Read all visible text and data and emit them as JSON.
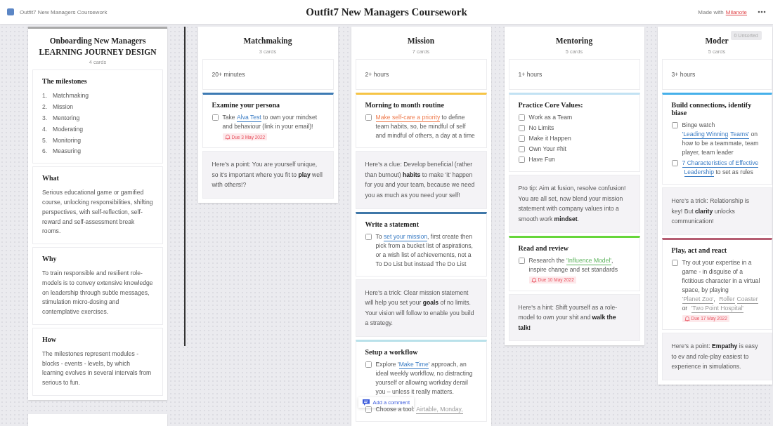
{
  "header": {
    "app_title": "Outfit7 New Managers Coursework",
    "board_title": "Outfit7 New Managers Coursework",
    "made_with": "Made with",
    "brand": "Milanote"
  },
  "unsorted_badge": "0 Unsorted",
  "columns": [
    {
      "kind": "intro",
      "title": "Onboarding New Managers\nLEARNING JOURNEY DESIGN",
      "count": "4 cards",
      "cards": [
        {
          "kind": "list",
          "title": "The milestones",
          "items": [
            {
              "number": "1.",
              "text": "Matchmaking"
            },
            {
              "number": "2.",
              "text": "Mission"
            },
            {
              "number": "3.",
              "text": "Mentoring"
            },
            {
              "number": "4.",
              "text": "Moderating"
            },
            {
              "number": "5.",
              "text": "Monitoring"
            },
            {
              "number": "6.",
              "text": "Measuring"
            }
          ]
        },
        {
          "kind": "section",
          "title": "What",
          "text": "Serious educational game or gamified course, unlocking responsibilities, shifting perspectives, with self-reflection, self-reward and self-assessment break rooms."
        },
        {
          "kind": "section",
          "title": "Why",
          "text": "To train responsible and resilient role-models is to convey extensive knowledge on leadership through subtle messages, stimulation micro-dosing and contemplative exercises."
        },
        {
          "kind": "section",
          "title": "How",
          "text": "The milestones represent modules - blocks - events - levels, by which learning evolves in several intervals from serious to fun."
        }
      ]
    },
    {
      "kind": "stage",
      "title": "Matchmaking",
      "count": "3 cards",
      "cards": [
        {
          "kind": "duration",
          "text": "20+ minutes"
        },
        {
          "kind": "task",
          "title": "Examine your persona",
          "color": "#3d7ab3",
          "tasks": [
            {
              "checked": false,
              "parts": [
                {
                  "kind": "text",
                  "text": "Take "
                },
                {
                  "kind": "link",
                  "text": "Alva Test",
                  "color": "#3a7cc4"
                },
                {
                  "kind": "text",
                  "text": " to own your mindset and behaviour (link in your email)!"
                }
              ],
              "due": "Due 3 May 2022"
            }
          ]
        },
        {
          "kind": "note",
          "text": "Here's a point: You are yourself unique, so it's important where you fit to **play** well with others!?"
        }
      ]
    },
    {
      "kind": "stage",
      "title": "Mission",
      "count": "7 cards",
      "cards": [
        {
          "kind": "duration",
          "text": "2+ hours"
        },
        {
          "kind": "task",
          "title": "Morning to month routine",
          "color": "#f6c445",
          "tasks": [
            {
              "checked": false,
              "parts": [
                {
                  "kind": "link",
                  "text": "Make self-care a priority",
                  "color": "#ef7a4c"
                },
                {
                  "kind": "text",
                  "text": " to define team habits, so, be mindful of self and mindful of others, a day at a time"
                }
              ]
            }
          ]
        },
        {
          "kind": "note",
          "text": "Here's a clue: Develop beneficial (rather than burnout) **habits** to make 'it' happen for you and your team, because we need you as much as you need your self!"
        },
        {
          "kind": "task",
          "title": "Write a statement",
          "color": "#3f77a8",
          "tasks": [
            {
              "checked": false,
              "parts": [
                {
                  "kind": "text",
                  "text": "To "
                },
                {
                  "kind": "link",
                  "text": "set your mission",
                  "color": "#3a7cc4"
                },
                {
                  "kind": "text",
                  "text": ", first create then pick from a bucket list of aspirations, or a wish list of achievements, not a To Do List but instead The Do List"
                }
              ]
            }
          ]
        },
        {
          "kind": "note",
          "text": "Here's a trick: Clear mission statement will help you set your **goals** of no limits. Your vision will follow to enable you build a strategy."
        },
        {
          "kind": "task",
          "title": "Setup a workflow",
          "color": "#b9e1ea",
          "tasks": [
            {
              "checked": false,
              "parts": [
                {
                  "kind": "text",
                  "text": "Explore '"
                },
                {
                  "kind": "link",
                  "text": "Make Time",
                  "color": "#3a7cc4"
                },
                {
                  "kind": "text",
                  "text": "' approach, an ideal weekly workflow, no distracting yourself or allowing workday derail you – unless it really matters."
                }
              ],
              "comment_prompt": "Add a comment"
            },
            {
              "checked": false,
              "parts": [
                {
                  "kind": "text",
                  "text": "Choose a tool: "
                },
                {
                  "kind": "link",
                  "text": "Airtable, Monday,",
                  "color": "#9a9a9a"
                }
              ]
            }
          ]
        }
      ]
    },
    {
      "kind": "stage",
      "title": "Mentoring",
      "count": "5 cards",
      "cards": [
        {
          "kind": "duration",
          "text": "1+ hours"
        },
        {
          "kind": "task",
          "title": "Practice Core Values:",
          "color": "#c2e2f3",
          "tasks": [
            {
              "checked": false,
              "parts": [
                {
                  "kind": "text",
                  "text": "Work as a Team"
                }
              ]
            },
            {
              "checked": false,
              "parts": [
                {
                  "kind": "text",
                  "text": "No Limits"
                }
              ]
            },
            {
              "checked": false,
              "parts": [
                {
                  "kind": "text",
                  "text": "Make it Happen"
                }
              ]
            },
            {
              "checked": false,
              "parts": [
                {
                  "kind": "text",
                  "text": "Own Your #hit"
                }
              ]
            },
            {
              "checked": false,
              "parts": [
                {
                  "kind": "text",
                  "text": "Have Fun"
                }
              ]
            }
          ]
        },
        {
          "kind": "note",
          "text": "Pro tip: Aim at fusion, resolve confusion! You are all set, now blend your mission statement with company values into a smooth work **mindset**."
        },
        {
          "kind": "task",
          "title": "Read and review",
          "color": "#66d63a",
          "tasks": [
            {
              "checked": false,
              "parts": [
                {
                  "kind": "text",
                  "text": "Research the "
                },
                {
                  "kind": "link",
                  "text": "'Influence Model'",
                  "color": "#5cb35c"
                },
                {
                  "kind": "text",
                  "text": ", inspire change and set standards"
                }
              ],
              "due": "Due 10 May 2022"
            }
          ]
        },
        {
          "kind": "note",
          "text": "Here's a hint: Shift yourself as a role-model to own your shit and **walk the talk!**"
        }
      ]
    },
    {
      "kind": "stage",
      "title": "Moder",
      "count": "5 cards",
      "cards": [
        {
          "kind": "duration",
          "text": "3+ hours"
        },
        {
          "kind": "task",
          "title": "Build connections, identify biase",
          "color": "#45b0ea",
          "tasks": [
            {
              "checked": false,
              "parts": [
                {
                  "kind": "text",
                  "text": "Binge watch "
                },
                {
                  "kind": "link",
                  "text": "'Leading Winning",
                  "color": "#3a7cc4"
                },
                {
                  "kind": "link",
                  "text": "Teams'",
                  "color": "#3a7cc4"
                },
                {
                  "kind": "text",
                  "text": " on how to be a teammate, team player, team leader"
                }
              ]
            },
            {
              "checked": false,
              "parts": [
                {
                  "kind": "link",
                  "text": "7 Characteristics of Effective",
                  "color": "#3a7cc4"
                },
                {
                  "kind": "link",
                  "text": "Leadership",
                  "color": "#3a7cc4"
                },
                {
                  "kind": "text",
                  "text": " to set as rules"
                }
              ]
            }
          ]
        },
        {
          "kind": "note",
          "text": "Here's a trick: Relationship is key! But **clarity** unlocks communication!"
        },
        {
          "kind": "task",
          "title": "Play, act and react",
          "color": "#b55d72",
          "tasks": [
            {
              "checked": false,
              "parts": [
                {
                  "kind": "text",
                  "text": "Try out your expertise in a game - in disguise of a fictitious character in a virtual space, by playing "
                },
                {
                  "kind": "link",
                  "text": "'Planet Zoo'",
                  "color": "#9a9a9a"
                },
                {
                  "kind": "text",
                  "text": ", "
                },
                {
                  "kind": "link",
                  "text": "Roller",
                  "color": "#9a9a9a"
                },
                {
                  "kind": "link",
                  "text": "Coaster",
                  "color": "#9a9a9a"
                },
                {
                  "kind": "text",
                  "text": " or "
                },
                {
                  "kind": "link",
                  "text": "'Two Point Hospital'",
                  "color": "#9a9a9a"
                }
              ],
              "due": "Due 17 May 2022"
            }
          ]
        },
        {
          "kind": "note",
          "text": "Here's a point: **Empathy** is easy to ev and role-play easiest to experience in simulations."
        }
      ]
    }
  ]
}
